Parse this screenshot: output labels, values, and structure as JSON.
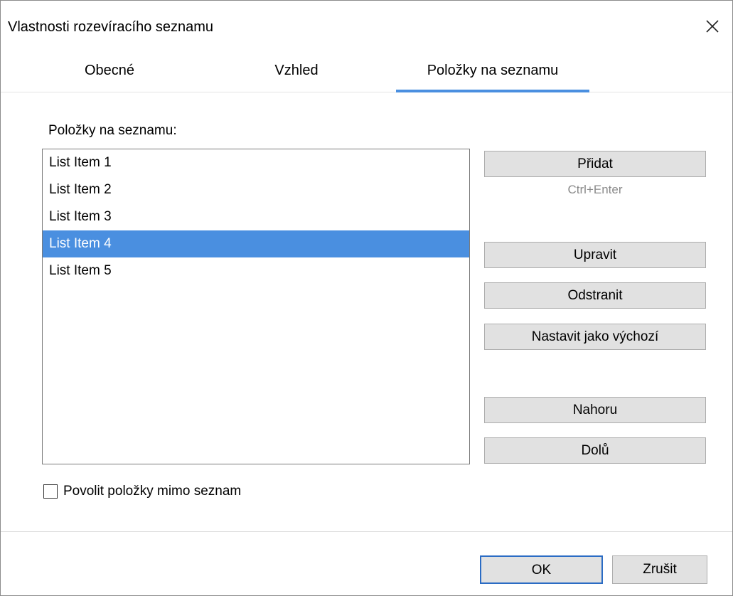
{
  "window": {
    "title": "Vlastnosti rozevíracího seznamu",
    "close_icon": "close-icon"
  },
  "tabs": [
    {
      "label": "Obecné",
      "active": false
    },
    {
      "label": "Vzhled",
      "active": false
    },
    {
      "label": "Položky na seznamu",
      "active": true
    }
  ],
  "main": {
    "list_label": "Položky na seznamu:",
    "items": [
      "List Item 1",
      "List Item 2",
      "List Item 3",
      "List Item 4",
      "List Item 5"
    ],
    "selected_item": "List Item 4"
  },
  "buttons": {
    "add": "Přidat",
    "add_shortcut": "Ctrl+Enter",
    "edit": "Upravit",
    "remove": "Odstranit",
    "set_default": "Nastavit jako výchozí",
    "up": "Nahoru",
    "down": "Dolů"
  },
  "checkbox": {
    "label": "Povolit položky mimo seznam",
    "checked": false
  },
  "footer": {
    "ok": "OK",
    "cancel": "Zrušit"
  },
  "colors": {
    "accent": "#4a8fe0",
    "button_bg": "#e1e1e1",
    "default_button_border": "#2b6cc4"
  }
}
